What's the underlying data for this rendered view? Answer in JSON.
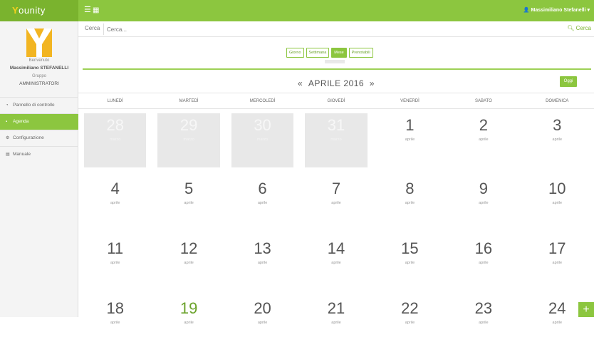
{
  "topbar": {
    "brand_prefix": "Y",
    "brand_name": "ounity",
    "menu_icon": "hamburger-icon",
    "grid_icon": "grid-icon",
    "user_label": "Massimiliano Stefanelli",
    "user_icon": "user-icon"
  },
  "sidebar": {
    "welcome": "Benvenuto",
    "username": "Massimiliano STEFANELLI",
    "group_label": "Gruppo",
    "group_value": "AMMINISTRATORI",
    "nav": [
      {
        "label": "Pannello di controllo",
        "icon": "dashboard-icon",
        "active": false
      },
      {
        "label": "Agenda",
        "icon": "calendar-icon",
        "active": true
      },
      {
        "label": "Configurazione",
        "icon": "gear-icon",
        "active": false
      },
      {
        "label": "Manuale",
        "icon": "document-icon",
        "active": false
      }
    ]
  },
  "search": {
    "label": "Cerca",
    "placeholder": "Cerca...",
    "button": "Cerca",
    "button_icon": "search-icon"
  },
  "views": [
    "Giorno",
    "Settimana",
    "Mese",
    "Prenotabili"
  ],
  "active_view": "Mese",
  "calendar": {
    "title": "APRILE 2016",
    "prev": "«",
    "next": "»",
    "today_button": "Oggi",
    "weekdays": [
      "LUNEDÌ",
      "MARTEDÌ",
      "MERCOLEDÌ",
      "GIOVEDÌ",
      "VENERDÌ",
      "SABATO",
      "DOMENICA"
    ],
    "weeks": [
      [
        {
          "n": "28",
          "m": "marzo",
          "past": true
        },
        {
          "n": "29",
          "m": "marzo",
          "past": true
        },
        {
          "n": "30",
          "m": "marzo",
          "past": true
        },
        {
          "n": "31",
          "m": "marzo",
          "past": true
        },
        {
          "n": "1",
          "m": "aprile",
          "past": false
        },
        {
          "n": "2",
          "m": "aprile",
          "past": false
        },
        {
          "n": "3",
          "m": "aprile",
          "past": false
        }
      ],
      [
        {
          "n": "4",
          "m": "aprile"
        },
        {
          "n": "5",
          "m": "aprile"
        },
        {
          "n": "6",
          "m": "aprile"
        },
        {
          "n": "7",
          "m": "aprile"
        },
        {
          "n": "8",
          "m": "aprile"
        },
        {
          "n": "9",
          "m": "aprile"
        },
        {
          "n": "10",
          "m": "aprile"
        }
      ],
      [
        {
          "n": "11",
          "m": "aprile"
        },
        {
          "n": "12",
          "m": "aprile"
        },
        {
          "n": "13",
          "m": "aprile"
        },
        {
          "n": "14",
          "m": "aprile"
        },
        {
          "n": "15",
          "m": "aprile"
        },
        {
          "n": "16",
          "m": "aprile"
        },
        {
          "n": "17",
          "m": "aprile"
        }
      ],
      [
        {
          "n": "18",
          "m": "aprile"
        },
        {
          "n": "19",
          "m": "aprile",
          "today": true
        },
        {
          "n": "20",
          "m": "aprile"
        },
        {
          "n": "21",
          "m": "aprile"
        },
        {
          "n": "22",
          "m": "aprile"
        },
        {
          "n": "23",
          "m": "aprile"
        },
        {
          "n": "24",
          "m": "aprile"
        }
      ]
    ]
  },
  "fab": {
    "label": "+",
    "icon": "plus-icon"
  },
  "colors": {
    "accent": "#8cc63f",
    "accent_dark": "#7ab32e",
    "logo": "#f2b522"
  }
}
